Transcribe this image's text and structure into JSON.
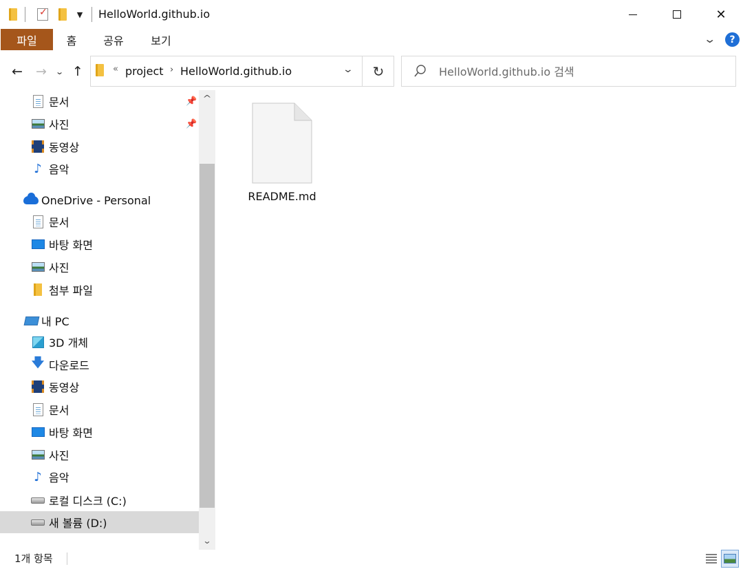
{
  "window": {
    "title": "HelloWorld.github.io",
    "minimize_label": "",
    "close_glyph": "✕"
  },
  "ribbon": {
    "tabs": [
      "파일",
      "홈",
      "공유",
      "보기"
    ],
    "help_label": "?"
  },
  "address": {
    "overflow_glyph": "«",
    "crumbs": [
      "project",
      "HelloWorld.github.io"
    ],
    "separator_glyph": "›",
    "refresh_glyph": "↻"
  },
  "search": {
    "placeholder": "HelloWorld.github.io 검색"
  },
  "nav": {
    "quick_access": [
      {
        "label": "문서",
        "icon": "documents-icon",
        "pinned": true
      },
      {
        "label": "사진",
        "icon": "pictures-icon",
        "pinned": true
      },
      {
        "label": "동영상",
        "icon": "videos-icon"
      },
      {
        "label": "음악",
        "icon": "music-icon"
      }
    ],
    "onedrive": {
      "label": "OneDrive - Personal",
      "items": [
        "문서",
        "바탕 화면",
        "사진",
        "첨부 파일"
      ]
    },
    "this_pc": {
      "label": "내 PC",
      "items": [
        "3D 개체",
        "다운로드",
        "동영상",
        "문서",
        "바탕 화면",
        "사진",
        "음악",
        "로컬 디스크 (C:)",
        "새 볼륨 (D:)"
      ]
    },
    "selected": "새 볼륨 (D:)"
  },
  "content": {
    "files": [
      {
        "name": "README.md",
        "icon": "blank-file-icon"
      }
    ]
  },
  "status": {
    "item_count": "1개 항목"
  },
  "colors": {
    "file_tab": "#a5561b",
    "accent": "#1f6fd6",
    "selection": "#d9d9d9"
  }
}
